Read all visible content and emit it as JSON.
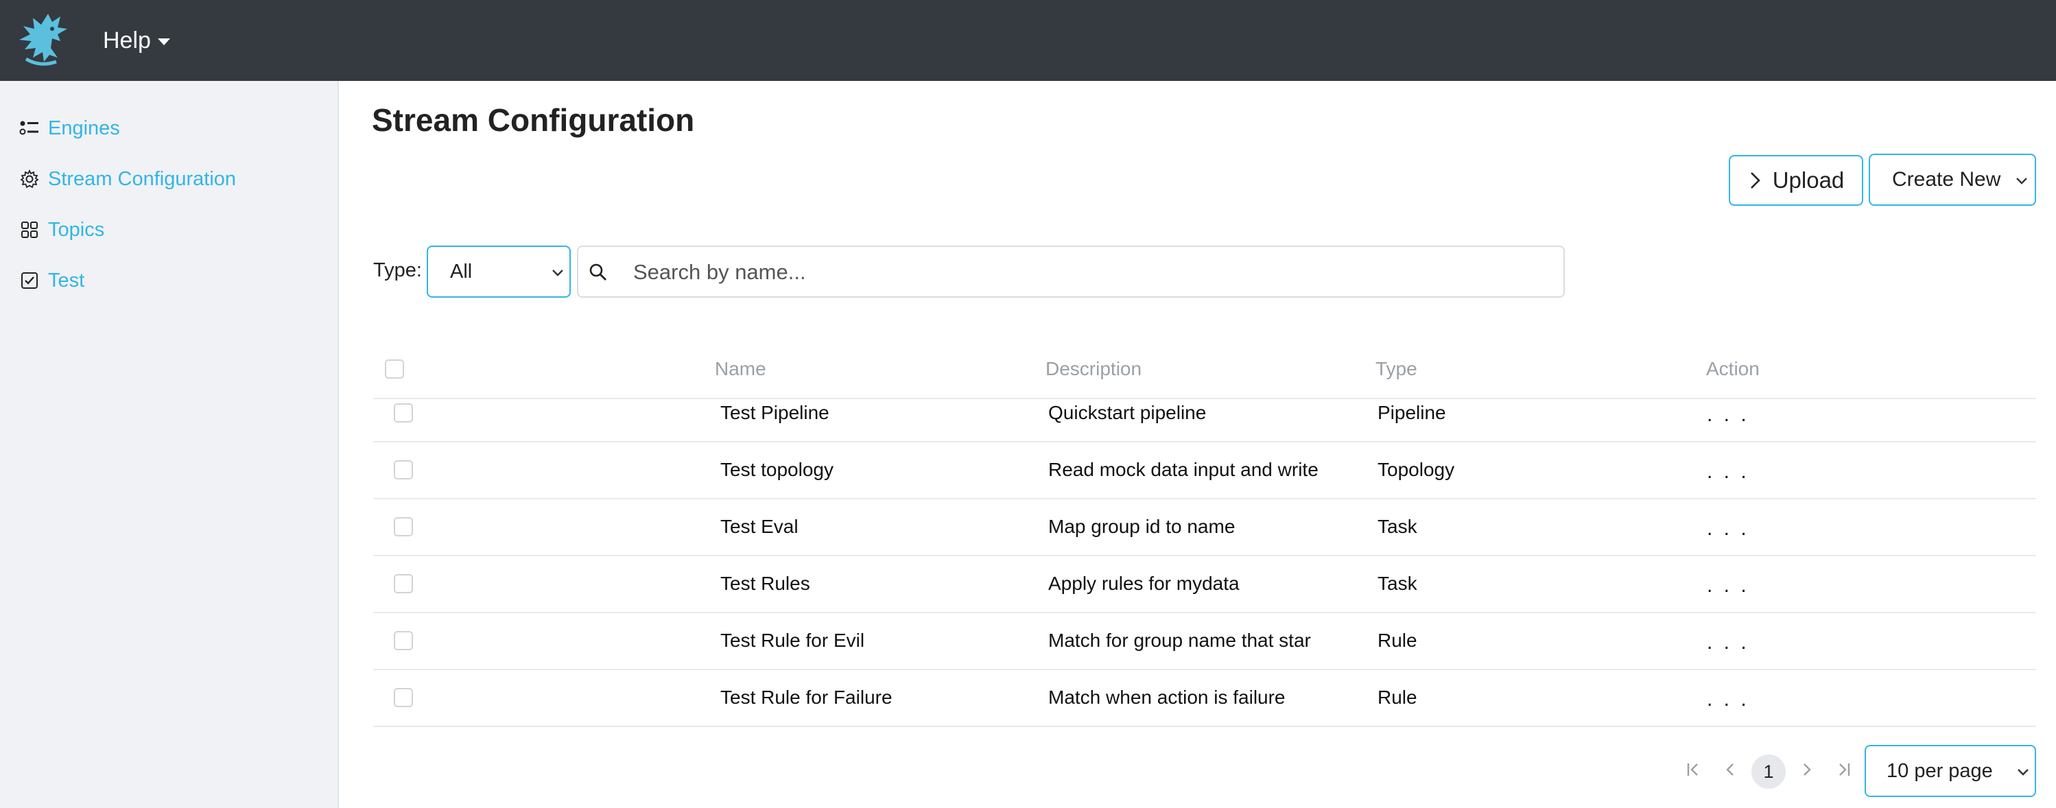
{
  "header": {
    "help_label": "Help"
  },
  "sidebar": {
    "items": [
      {
        "label": "Engines",
        "icon": "list-icon"
      },
      {
        "label": "Stream Configuration",
        "icon": "gear-icon"
      },
      {
        "label": "Topics",
        "icon": "grid-icon"
      },
      {
        "label": "Test",
        "icon": "checkbox-icon"
      }
    ]
  },
  "main": {
    "title": "Stream Configuration",
    "upload_label": "Upload",
    "create_label": "Create New",
    "type_label": "Type:",
    "type_value": "All",
    "search_placeholder": "Search by name..."
  },
  "table": {
    "columns": [
      "Name",
      "Description",
      "Type",
      "Action"
    ],
    "rows": [
      {
        "name": "Test Pipeline",
        "description": "Quickstart pipeline",
        "type": "Pipeline",
        "action": ". . ."
      },
      {
        "name": "Test topology",
        "description": "Read mock data input and write",
        "type": "Topology",
        "action": ". . ."
      },
      {
        "name": "Test Eval",
        "description": "Map group id to name",
        "type": "Task",
        "action": ". . ."
      },
      {
        "name": "Test Rules",
        "description": "Apply rules for mydata",
        "type": "Task",
        "action": ". . ."
      },
      {
        "name": "Test Rule for Evil",
        "description": "Match for group name that star",
        "type": "Rule",
        "action": ". . ."
      },
      {
        "name": "Test Rule for Failure",
        "description": "Match when action is failure",
        "type": "Rule",
        "action": ". . ."
      }
    ]
  },
  "pagination": {
    "current_page": "1",
    "per_page_label": "10 per page"
  },
  "colors": {
    "accent": "#33b5e5",
    "topbar": "#343a40",
    "sidebar_bg": "#f0f2f5"
  }
}
